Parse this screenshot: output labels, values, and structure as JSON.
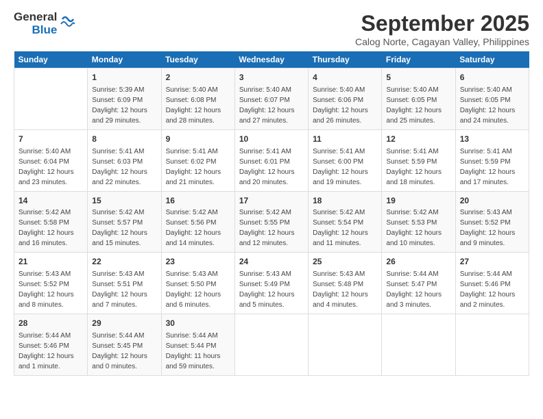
{
  "logo": {
    "line1": "General",
    "line2": "Blue"
  },
  "title": {
    "main": "September 2025",
    "sub": "Calog Norte, Cagayan Valley, Philippines"
  },
  "headers": [
    "Sunday",
    "Monday",
    "Tuesday",
    "Wednesday",
    "Thursday",
    "Friday",
    "Saturday"
  ],
  "weeks": [
    [
      {
        "num": "",
        "info": ""
      },
      {
        "num": "1",
        "info": "Sunrise: 5:39 AM\nSunset: 6:09 PM\nDaylight: 12 hours\nand 29 minutes."
      },
      {
        "num": "2",
        "info": "Sunrise: 5:40 AM\nSunset: 6:08 PM\nDaylight: 12 hours\nand 28 minutes."
      },
      {
        "num": "3",
        "info": "Sunrise: 5:40 AM\nSunset: 6:07 PM\nDaylight: 12 hours\nand 27 minutes."
      },
      {
        "num": "4",
        "info": "Sunrise: 5:40 AM\nSunset: 6:06 PM\nDaylight: 12 hours\nand 26 minutes."
      },
      {
        "num": "5",
        "info": "Sunrise: 5:40 AM\nSunset: 6:05 PM\nDaylight: 12 hours\nand 25 minutes."
      },
      {
        "num": "6",
        "info": "Sunrise: 5:40 AM\nSunset: 6:05 PM\nDaylight: 12 hours\nand 24 minutes."
      }
    ],
    [
      {
        "num": "7",
        "info": "Sunrise: 5:40 AM\nSunset: 6:04 PM\nDaylight: 12 hours\nand 23 minutes."
      },
      {
        "num": "8",
        "info": "Sunrise: 5:41 AM\nSunset: 6:03 PM\nDaylight: 12 hours\nand 22 minutes."
      },
      {
        "num": "9",
        "info": "Sunrise: 5:41 AM\nSunset: 6:02 PM\nDaylight: 12 hours\nand 21 minutes."
      },
      {
        "num": "10",
        "info": "Sunrise: 5:41 AM\nSunset: 6:01 PM\nDaylight: 12 hours\nand 20 minutes."
      },
      {
        "num": "11",
        "info": "Sunrise: 5:41 AM\nSunset: 6:00 PM\nDaylight: 12 hours\nand 19 minutes."
      },
      {
        "num": "12",
        "info": "Sunrise: 5:41 AM\nSunset: 5:59 PM\nDaylight: 12 hours\nand 18 minutes."
      },
      {
        "num": "13",
        "info": "Sunrise: 5:41 AM\nSunset: 5:59 PM\nDaylight: 12 hours\nand 17 minutes."
      }
    ],
    [
      {
        "num": "14",
        "info": "Sunrise: 5:42 AM\nSunset: 5:58 PM\nDaylight: 12 hours\nand 16 minutes."
      },
      {
        "num": "15",
        "info": "Sunrise: 5:42 AM\nSunset: 5:57 PM\nDaylight: 12 hours\nand 15 minutes."
      },
      {
        "num": "16",
        "info": "Sunrise: 5:42 AM\nSunset: 5:56 PM\nDaylight: 12 hours\nand 14 minutes."
      },
      {
        "num": "17",
        "info": "Sunrise: 5:42 AM\nSunset: 5:55 PM\nDaylight: 12 hours\nand 12 minutes."
      },
      {
        "num": "18",
        "info": "Sunrise: 5:42 AM\nSunset: 5:54 PM\nDaylight: 12 hours\nand 11 minutes."
      },
      {
        "num": "19",
        "info": "Sunrise: 5:42 AM\nSunset: 5:53 PM\nDaylight: 12 hours\nand 10 minutes."
      },
      {
        "num": "20",
        "info": "Sunrise: 5:43 AM\nSunset: 5:52 PM\nDaylight: 12 hours\nand 9 minutes."
      }
    ],
    [
      {
        "num": "21",
        "info": "Sunrise: 5:43 AM\nSunset: 5:52 PM\nDaylight: 12 hours\nand 8 minutes."
      },
      {
        "num": "22",
        "info": "Sunrise: 5:43 AM\nSunset: 5:51 PM\nDaylight: 12 hours\nand 7 minutes."
      },
      {
        "num": "23",
        "info": "Sunrise: 5:43 AM\nSunset: 5:50 PM\nDaylight: 12 hours\nand 6 minutes."
      },
      {
        "num": "24",
        "info": "Sunrise: 5:43 AM\nSunset: 5:49 PM\nDaylight: 12 hours\nand 5 minutes."
      },
      {
        "num": "25",
        "info": "Sunrise: 5:43 AM\nSunset: 5:48 PM\nDaylight: 12 hours\nand 4 minutes."
      },
      {
        "num": "26",
        "info": "Sunrise: 5:44 AM\nSunset: 5:47 PM\nDaylight: 12 hours\nand 3 minutes."
      },
      {
        "num": "27",
        "info": "Sunrise: 5:44 AM\nSunset: 5:46 PM\nDaylight: 12 hours\nand 2 minutes."
      }
    ],
    [
      {
        "num": "28",
        "info": "Sunrise: 5:44 AM\nSunset: 5:46 PM\nDaylight: 12 hours\nand 1 minute."
      },
      {
        "num": "29",
        "info": "Sunrise: 5:44 AM\nSunset: 5:45 PM\nDaylight: 12 hours\nand 0 minutes."
      },
      {
        "num": "30",
        "info": "Sunrise: 5:44 AM\nSunset: 5:44 PM\nDaylight: 11 hours\nand 59 minutes."
      },
      {
        "num": "",
        "info": ""
      },
      {
        "num": "",
        "info": ""
      },
      {
        "num": "",
        "info": ""
      },
      {
        "num": "",
        "info": ""
      }
    ]
  ]
}
